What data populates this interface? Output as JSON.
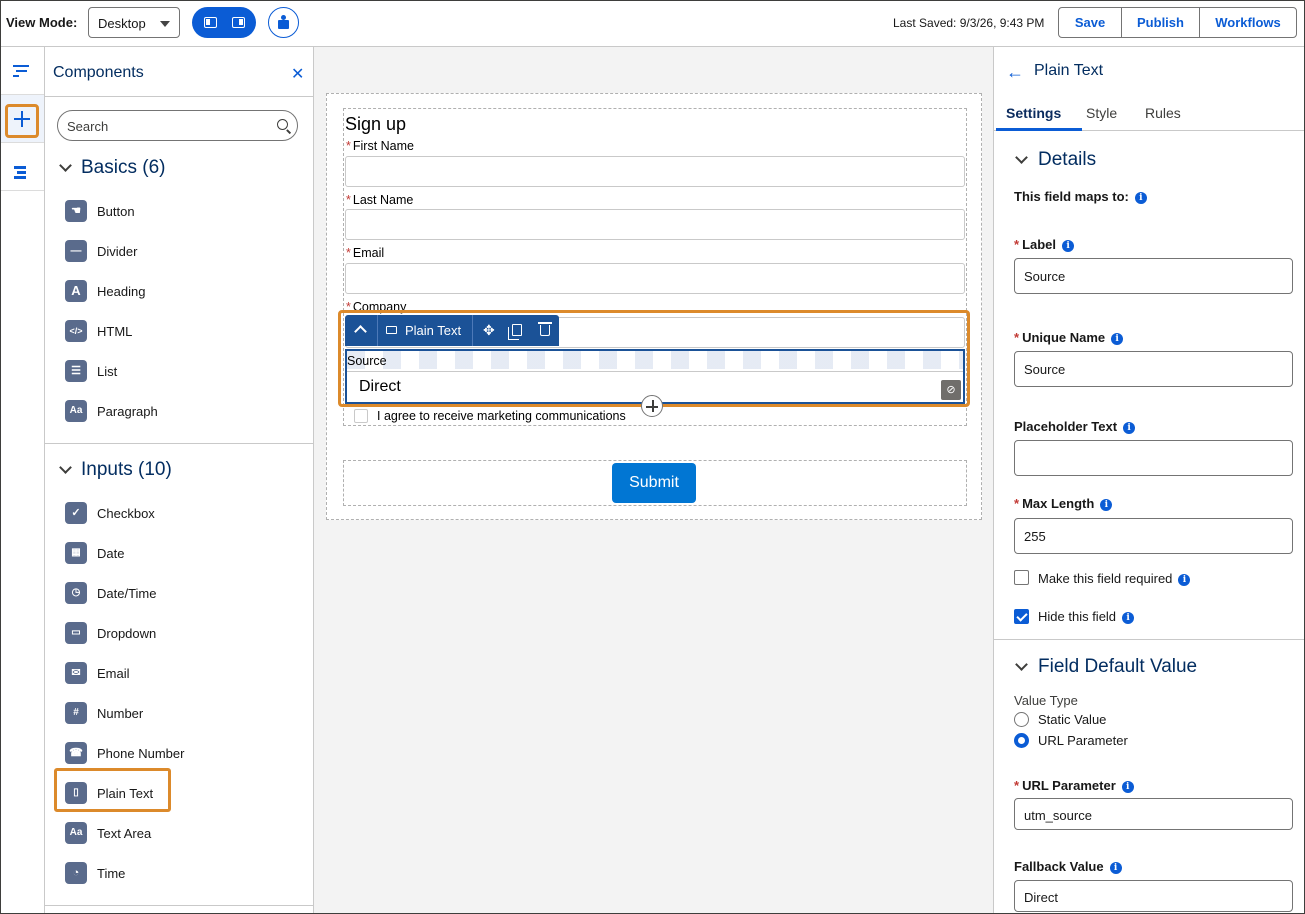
{
  "topbar": {
    "view_mode_label": "View Mode:",
    "view_mode_value": "Desktop",
    "last_saved": "Last Saved: 9/3/26, 9:43 PM",
    "save_label": "Save",
    "publish_label": "Publish",
    "workflows_label": "Workflows"
  },
  "components": {
    "title": "Components",
    "search_placeholder": "Search",
    "basics_heading": "Basics (6)",
    "basics": [
      {
        "label": "Button",
        "icon": "button-icon"
      },
      {
        "label": "Divider",
        "icon": "divider-icon"
      },
      {
        "label": "Heading",
        "icon": "heading-icon"
      },
      {
        "label": "HTML",
        "icon": "html-icon"
      },
      {
        "label": "List",
        "icon": "list-icon"
      },
      {
        "label": "Paragraph",
        "icon": "paragraph-icon"
      }
    ],
    "inputs_heading": "Inputs (10)",
    "inputs": [
      {
        "label": "Checkbox",
        "icon": "checkbox-icon"
      },
      {
        "label": "Date",
        "icon": "date-icon"
      },
      {
        "label": "Date/Time",
        "icon": "datetime-icon"
      },
      {
        "label": "Dropdown",
        "icon": "dropdown-icon"
      },
      {
        "label": "Email",
        "icon": "email-icon"
      },
      {
        "label": "Number",
        "icon": "number-icon"
      },
      {
        "label": "Phone Number",
        "icon": "phone-icon"
      },
      {
        "label": "Plain Text",
        "icon": "plain-text-icon"
      },
      {
        "label": "Text Area",
        "icon": "text-area-icon"
      },
      {
        "label": "Time",
        "icon": "time-icon"
      }
    ]
  },
  "form": {
    "title": "Sign up",
    "fields": [
      {
        "label": "First Name",
        "required": true
      },
      {
        "label": "Last Name",
        "required": true
      },
      {
        "label": "Email",
        "required": true
      },
      {
        "label": "Company",
        "required": true
      }
    ],
    "selected_field": {
      "label": "Source",
      "value": "Direct"
    },
    "toolbar_label": "Plain Text",
    "checkbox_label": "I agree to receive marketing communications",
    "submit_label": "Submit"
  },
  "properties": {
    "title": "Plain Text",
    "tabs": [
      "Settings",
      "Style",
      "Rules"
    ],
    "details_heading": "Details",
    "maps_to_label": "This field maps to:",
    "label_label": "Label",
    "label_value": "Source",
    "unique_name_label": "Unique Name",
    "unique_name_value": "Source",
    "placeholder_label": "Placeholder Text",
    "placeholder_value": "",
    "max_length_label": "Max Length",
    "max_length_value": "255",
    "required_label": "Make this field required",
    "required_checked": false,
    "hide_label": "Hide this field",
    "hide_checked": true,
    "default_heading": "Field Default Value",
    "value_type_label": "Value Type",
    "static_value_label": "Static Value",
    "url_param_option_label": "URL Parameter",
    "url_param_label": "URL Parameter",
    "url_param_value": "utm_source",
    "fallback_label": "Fallback Value",
    "fallback_value": "Direct"
  },
  "colors": {
    "brand": "#0b5cd5",
    "highlight": "#dc8a2b",
    "selected": "#1b5297",
    "submit": "#0176d3"
  }
}
